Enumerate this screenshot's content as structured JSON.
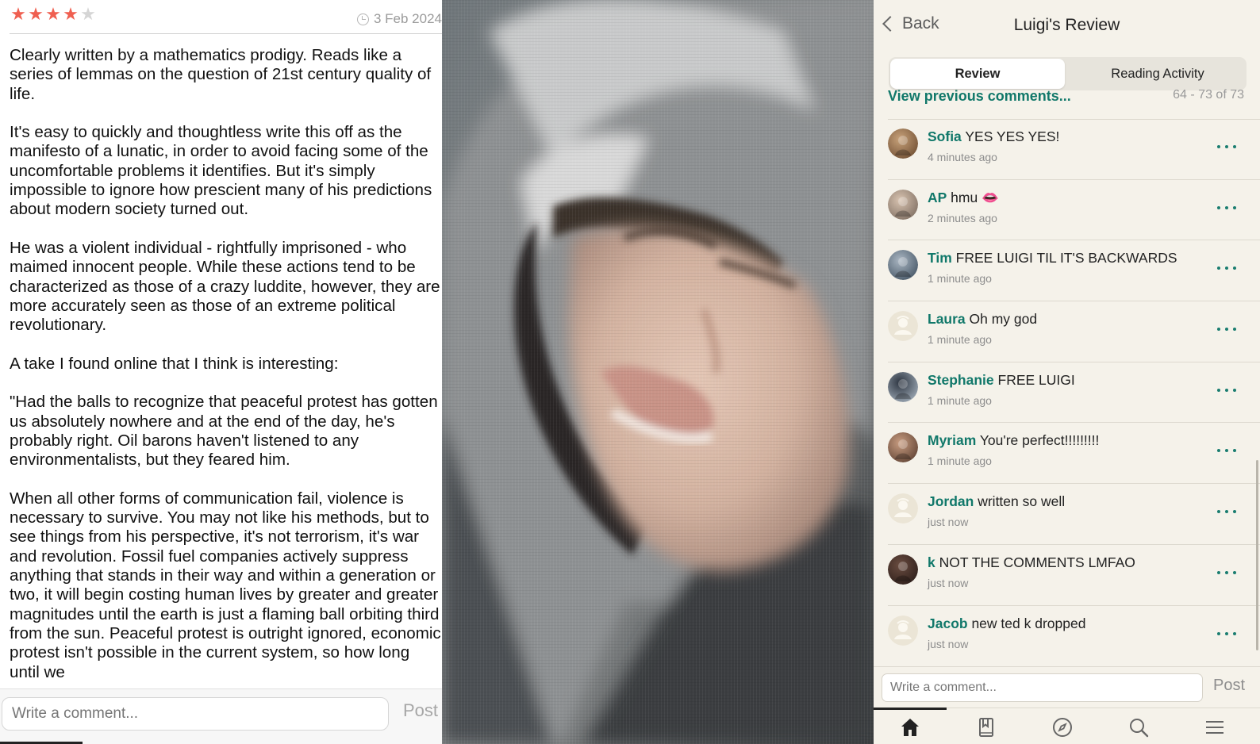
{
  "left_review": {
    "rating": 4,
    "rating_max": 5,
    "date": "3 Feb 2024",
    "paragraphs": [
      "Clearly written by a mathematics prodigy. Reads like a series of lemmas on the question of 21st century quality of life.",
      "It's easy to quickly and thoughtless write this off as the manifesto of a lunatic, in order to avoid facing some of the uncomfortable problems it identifies. But it's simply impossible to ignore how prescient many of his predictions about modern society turned out.",
      "He was a violent individual - rightfully imprisoned - who maimed innocent people. While these actions tend to be characterized as those of a crazy luddite, however, they are more accurately seen as those of an extreme political revolutionary.",
      "A take I found online that I think is interesting:",
      "\"Had the balls to recognize that peaceful protest has gotten us absolutely nowhere and at the end of the day, he's probably right. Oil barons haven't listened to any environmentalists, but they feared him.",
      "When all other forms of communication fail, violence is necessary to survive. You may not like his methods, but to see things from his perspective, it's not terrorism, it's war and revolution. Fossil fuel companies actively suppress anything that stands in their way and within a generation or two, it will begin costing human lives by greater and greater magnitudes until the earth is just a flaming ball orbiting third from the sun. Peaceful protest is outright ignored, economic protest isn't possible in the current system, so how long until we"
    ],
    "comment_placeholder": "Write a comment...",
    "post_label": "Post",
    "star_color": "#ef5f50"
  },
  "right_panel": {
    "back_label": "Back",
    "title": "Luigi's Review",
    "tabs": [
      "Review",
      "Reading Activity"
    ],
    "active_tab": "Review",
    "view_previous": "View previous comments...",
    "range": "64 - 73 of 73",
    "comments": [
      {
        "user": "Sofia",
        "text": "YES YES YES!",
        "time": "4 minutes ago",
        "avatar": "photo"
      },
      {
        "user": "AP",
        "text": "hmu 👄",
        "time": "2 minutes ago",
        "avatar": "photo"
      },
      {
        "user": "Tim",
        "text": "FREE LUIGI TIL IT'S BACKWARDS",
        "time": "1 minute ago",
        "avatar": "photo"
      },
      {
        "user": "Laura",
        "text": "Oh my god",
        "time": "1 minute ago",
        "avatar": "default"
      },
      {
        "user": "Stephanie",
        "text": "FREE LUIGI",
        "time": "1 minute ago",
        "avatar": "photo"
      },
      {
        "user": "Myriam",
        "text": "You're perfect!!!!!!!!!",
        "time": "1 minute ago",
        "avatar": "photo"
      },
      {
        "user": "Jordan",
        "text": "written so well",
        "time": "just now",
        "avatar": "default"
      },
      {
        "user": "k",
        "text": "NOT THE COMMENTS LMFAO",
        "time": "just now",
        "avatar": "photo"
      },
      {
        "user": "Jacob",
        "text": "new ted k dropped",
        "time": "just now",
        "avatar": "default"
      }
    ],
    "comment_placeholder": "Write a comment...",
    "post_label": "Post",
    "tabbar_icons": [
      "home-icon",
      "bookmark-book-icon",
      "compass-icon",
      "search-icon",
      "menu-icon"
    ],
    "accent_color": "#11786a",
    "background_color": "#f5f2ea"
  }
}
